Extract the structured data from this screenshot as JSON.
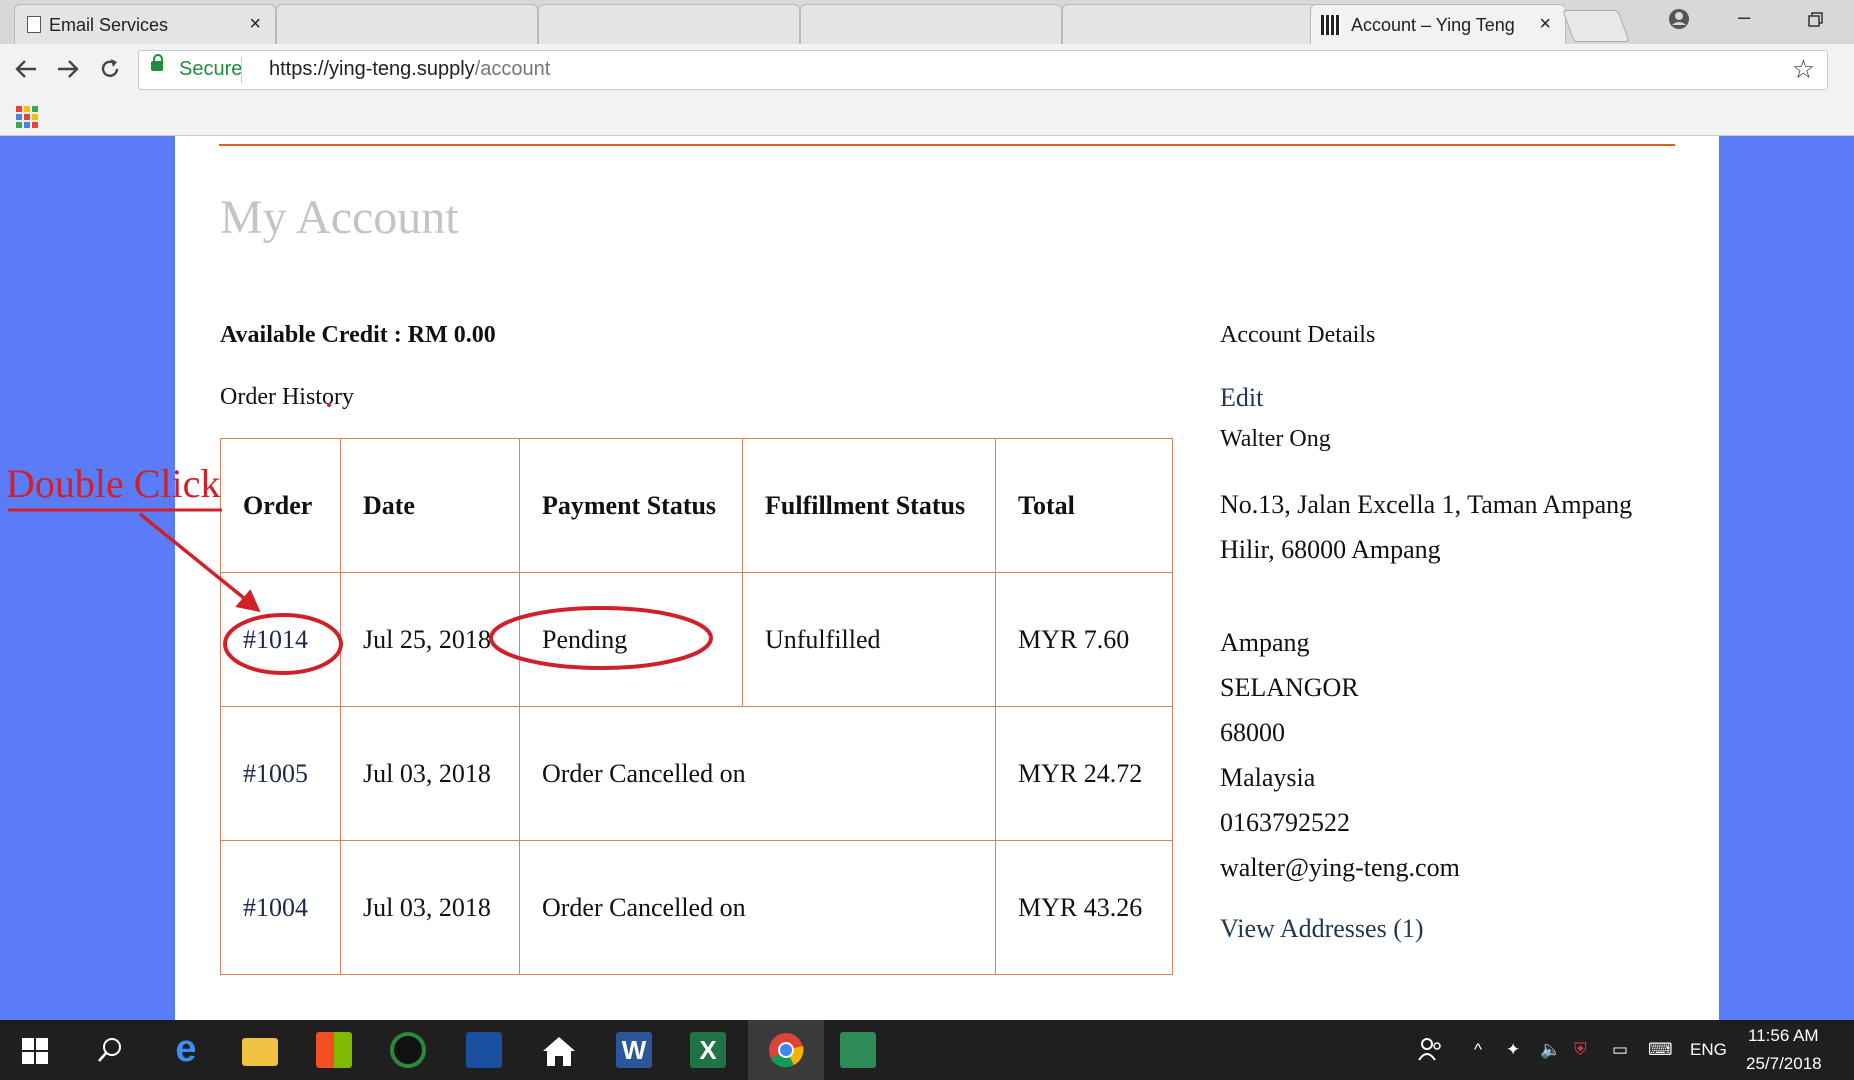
{
  "browser": {
    "tabs": [
      {
        "label": "Email Services",
        "active": false,
        "close": "×"
      },
      {
        "label": "",
        "active": false
      },
      {
        "label": "",
        "active": false
      },
      {
        "label": "",
        "active": false
      },
      {
        "label": "",
        "active": false
      },
      {
        "label": "Account – Ying Teng",
        "active": true,
        "close": "×"
      }
    ],
    "secure_label": "Secure",
    "url_scheme_host": "https://ying-teng.supply",
    "url_path": "/account"
  },
  "page": {
    "title": "My Account",
    "available_credit": "Available Credit : RM 0.00",
    "order_history_label": "Order History",
    "table": {
      "headers": [
        "Order",
        "Date",
        "Payment Status",
        "Fulfillment Status",
        "Total"
      ],
      "rows": [
        {
          "order": "#1014",
          "date": "Jul 25, 2018",
          "payment": "Pending",
          "fulfillment": "Unfulfilled",
          "total": "MYR 7.60"
        },
        {
          "order": "#1005",
          "date": "Jul 03, 2018",
          "status": "Order Cancelled on",
          "total": "MYR 24.72"
        },
        {
          "order": "#1004",
          "date": "Jul 03, 2018",
          "status": "Order Cancelled on",
          "total": "MYR 43.26"
        }
      ]
    },
    "account": {
      "title": "Account Details",
      "edit_label": "Edit",
      "name": "Walter Ong",
      "address": "No.13, Jalan Excella 1, Taman Ampang Hilir, 68000 Ampang",
      "city": "Ampang",
      "state": "SELANGOR",
      "postcode": "68000",
      "country": "Malaysia",
      "phone": "0163792522",
      "email": "walter@ying-teng.com",
      "view_addresses": "View Addresses (1)"
    }
  },
  "annotation": {
    "text": "Double Click",
    "color": "#d02028"
  },
  "taskbar": {
    "time": "11:56 AM",
    "date": "25/7/2018",
    "language": "ENG"
  },
  "colors": {
    "background_accent": "#5b7cf8",
    "table_border": "#e08060",
    "top_rule": "#e06020",
    "secure_green": "#1e8e3e"
  }
}
